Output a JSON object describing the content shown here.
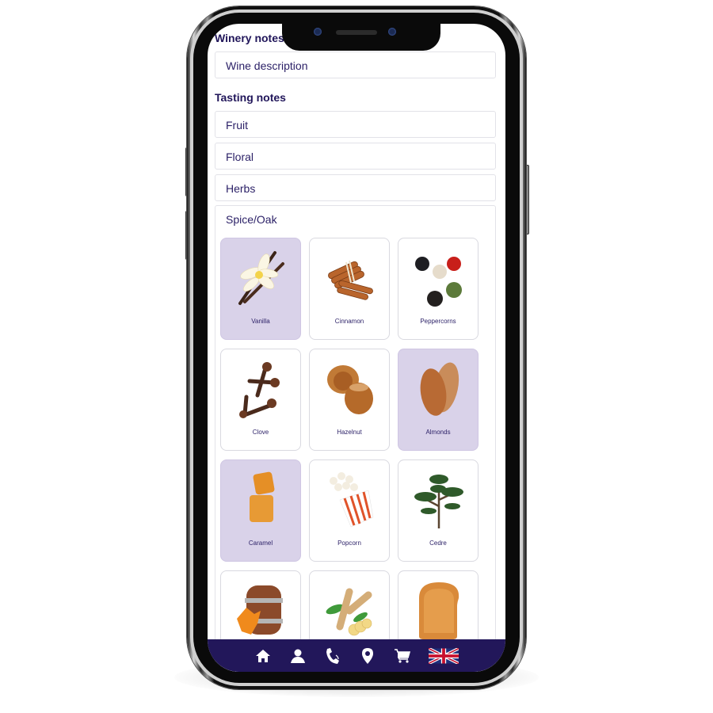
{
  "winery_notes": {
    "title": "Winery notes",
    "field_label": "Wine description"
  },
  "tasting_notes": {
    "title": "Tasting notes",
    "categories": [
      {
        "label": "Fruit",
        "expanded": false
      },
      {
        "label": "Floral",
        "expanded": false
      },
      {
        "label": "Herbs",
        "expanded": false
      },
      {
        "label": "Spice/Oak",
        "expanded": true
      }
    ],
    "spice_oak_items": [
      {
        "label": "Vanilla",
        "icon": "vanilla-icon",
        "selected": true
      },
      {
        "label": "Cinnamon",
        "icon": "cinnamon-icon",
        "selected": false
      },
      {
        "label": "Peppercorns",
        "icon": "peppercorns-icon",
        "selected": false
      },
      {
        "label": "Clove",
        "icon": "clove-icon",
        "selected": false
      },
      {
        "label": "Hazelnut",
        "icon": "hazelnut-icon",
        "selected": false
      },
      {
        "label": "Almonds",
        "icon": "almonds-icon",
        "selected": true
      },
      {
        "label": "Caramel",
        "icon": "caramel-icon",
        "selected": true
      },
      {
        "label": "Popcorn",
        "icon": "popcorn-icon",
        "selected": false
      },
      {
        "label": "Cedre",
        "icon": "cedar-tree-icon",
        "selected": false
      },
      {
        "label": "",
        "icon": "oak-barrel-icon",
        "selected": false
      },
      {
        "label": "",
        "icon": "ginger-icon",
        "selected": false
      },
      {
        "label": "",
        "icon": "toast-icon",
        "selected": false
      }
    ]
  },
  "bottom_nav": {
    "items": [
      {
        "icon": "home-icon"
      },
      {
        "icon": "user-icon"
      },
      {
        "icon": "phone-icon"
      },
      {
        "icon": "location-pin-icon"
      },
      {
        "icon": "cart-icon"
      },
      {
        "icon": "uk-flag-icon"
      }
    ]
  },
  "colors": {
    "primary": "#22175a",
    "text": "#2a1f66",
    "selected_card": "#d9d2e9",
    "border": "#e2e2e8"
  }
}
